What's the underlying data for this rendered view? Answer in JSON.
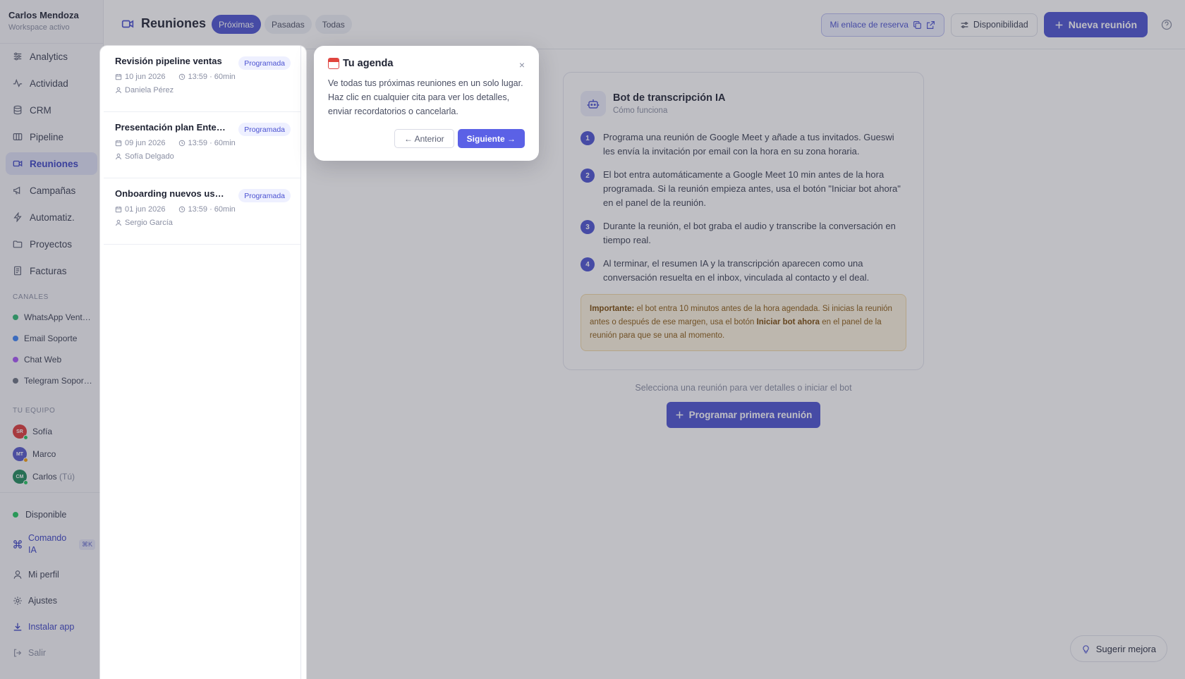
{
  "workspace": {
    "name": "Carlos Mendoza",
    "status": "Workspace activo"
  },
  "nav": [
    {
      "label": "Analytics",
      "icon": "sliders-icon"
    },
    {
      "label": "Actividad",
      "icon": "activity-icon"
    },
    {
      "label": "CRM",
      "icon": "database-icon"
    },
    {
      "label": "Pipeline",
      "icon": "pipeline-icon"
    },
    {
      "label": "Reuniones",
      "icon": "video-icon",
      "active": true
    },
    {
      "label": "Campañas",
      "icon": "megaphone-icon"
    },
    {
      "label": "Automatiz.",
      "icon": "bolt-icon"
    },
    {
      "label": "Proyectos",
      "icon": "folder-icon"
    },
    {
      "label": "Facturas",
      "icon": "receipt-icon"
    }
  ],
  "channels": {
    "title": "CANALES",
    "items": [
      {
        "label": "WhatsApp Vent…",
        "color": "#2eb872"
      },
      {
        "label": "Email Soporte",
        "color": "#3b82f6"
      },
      {
        "label": "Chat Web",
        "color": "#a855f7"
      },
      {
        "label": "Telegram Sopor…",
        "color": "#6b7280"
      }
    ]
  },
  "team": {
    "title": "TU EQUIPO",
    "members": [
      {
        "initials": "SR",
        "name": "Sofía",
        "you": "",
        "color": "#dc3a3a",
        "status": "#22c55e"
      },
      {
        "initials": "MT",
        "name": "Marco",
        "you": "",
        "color": "#5457c9",
        "status": "#f59e0b"
      },
      {
        "initials": "CM",
        "name": "Carlos",
        "you": "(Tú)",
        "color": "#1f8a5a",
        "status": "#22c55e"
      }
    ]
  },
  "bottom": {
    "available": "Disponible",
    "command": "Comando IA",
    "command_kbd": "⌘K",
    "profile": "Mi perfil",
    "settings": "Ajustes",
    "install": "Instalar app",
    "logout": "Salir"
  },
  "header": {
    "title": "Reuniones",
    "tabs": [
      {
        "label": "Próximas",
        "active": true
      },
      {
        "label": "Pasadas"
      },
      {
        "label": "Todas"
      }
    ],
    "booking_link": "Mi enlace de reserva",
    "availability": "Disponibilidad",
    "new_meeting": "Nueva reunión"
  },
  "meetings": [
    {
      "title": "Revisión pipeline ventas",
      "status": "Programada",
      "date": "10 jun 2026",
      "time": "13:59 · 60min",
      "person": "Daniela Pérez"
    },
    {
      "title": "Presentación plan Enterprise",
      "status": "Programada",
      "date": "09 jun 2026",
      "time": "13:59 · 60min",
      "person": "Sofía Delgado"
    },
    {
      "title": "Onboarding nuevos usuarios",
      "status": "Programada",
      "date": "01 jun 2026",
      "time": "13:59 · 60min",
      "person": "Sergio García"
    }
  ],
  "bot_card": {
    "title": "Bot de transcripción IA",
    "subtitle": "Cómo funciona",
    "steps": [
      {
        "num": "1",
        "text": "Programa una reunión de Google Meet y añade a tus invitados. Gueswi les envía la invitación por email con la hora en su zona horaria."
      },
      {
        "num": "2",
        "text": "El bot entra automáticamente a Google Meet 10 min antes de la hora programada. Si la reunión empieza antes, usa el botón \"Iniciar bot ahora\" en el panel de la reunión."
      },
      {
        "num": "3",
        "text": "Durante la reunión, el bot graba el audio y transcribe la conversación en tiempo real."
      },
      {
        "num": "4",
        "text": "Al terminar, el resumen IA y la transcripción aparecen como una conversación resuelta en el inbox, vinculada al contacto y el deal."
      }
    ],
    "note_label": "Importante:",
    "note_text_1": " el bot entra 10 minutos antes de la hora agendada. Si inicias la reunión antes o después de ese margen, usa el botón ",
    "note_strong": "Iniciar bot ahora",
    "note_text_2": " en el panel de la reunión para que se una al momento."
  },
  "empty_hint": "Selecciona una reunión para ver detalles o iniciar el bot",
  "cta": "Programar primera reunión",
  "suggest": "Sugerir mejora",
  "tour": {
    "title": "Tu agenda",
    "body": "Ve todas tus próximas reuniones en un solo lugar. Haz clic en cualquier cita para ver los detalles, enviar recordatorios o cancelarla.",
    "prev": "← Anterior",
    "next": "Siguiente →",
    "close": "×"
  }
}
